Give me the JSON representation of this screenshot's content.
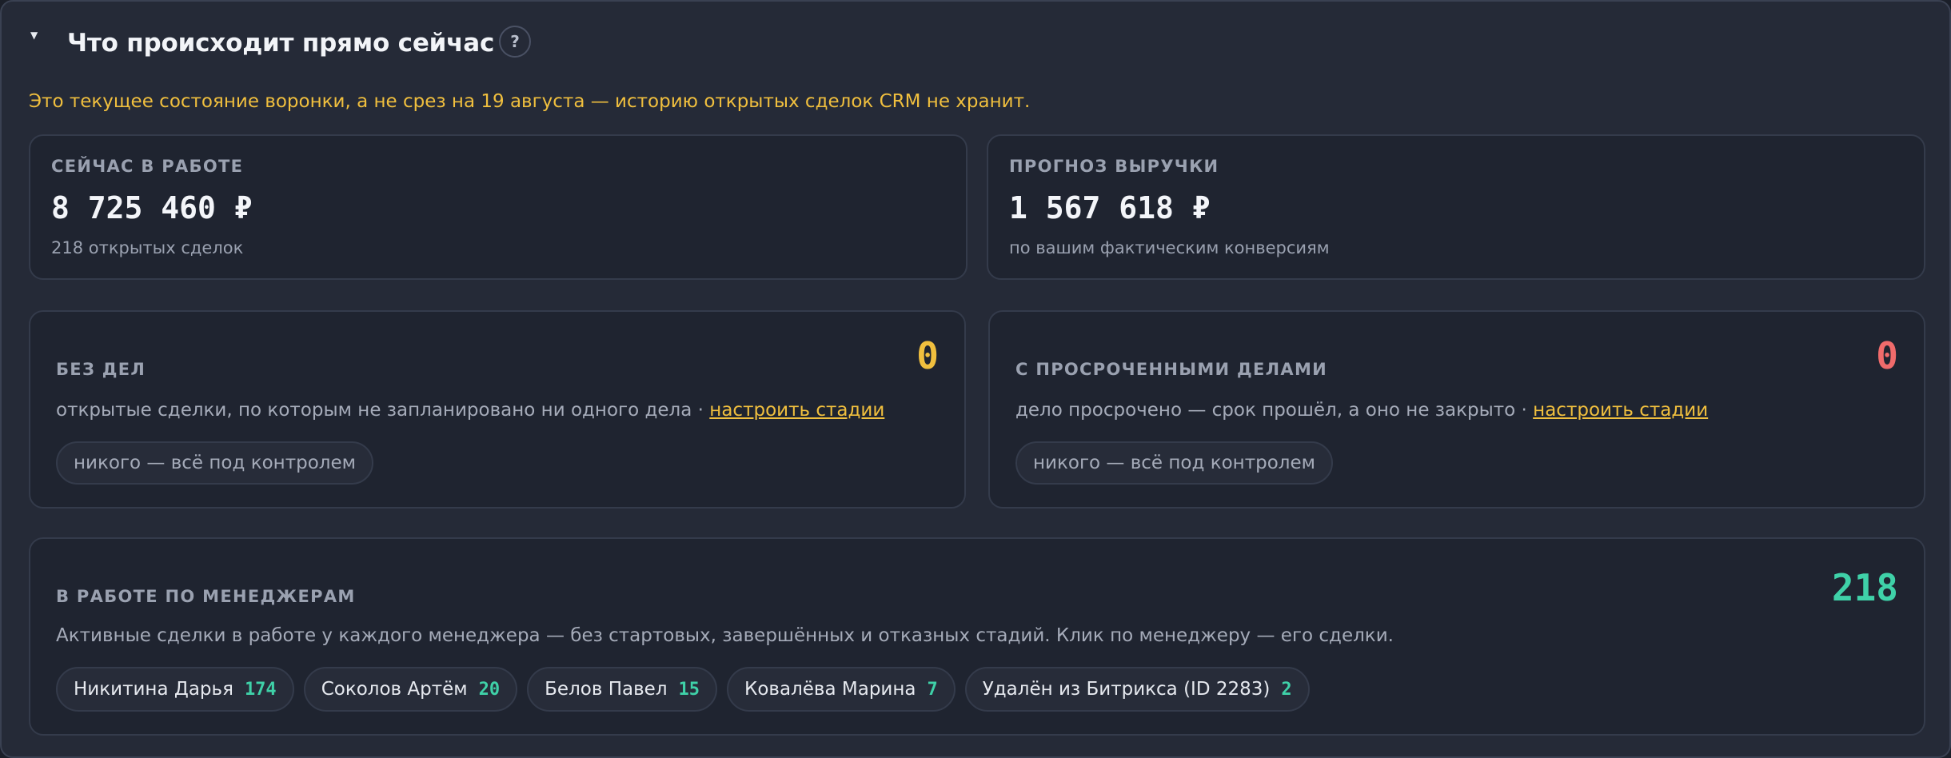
{
  "header": {
    "title": "Что происходит прямо сейчас",
    "help_label": "?"
  },
  "notice": "Это текущее состояние воронки, а не срез на 19 августа — историю открытых сделок CRM не хранит.",
  "in_work": {
    "label": "Сейчас в работе",
    "value": "8 725 460 ₽",
    "sub": "218 открытых сделок"
  },
  "forecast": {
    "label": "Прогноз выручки",
    "value": "1 567 618 ₽",
    "sub": "по вашим фактическим конверсиям"
  },
  "no_tasks": {
    "label": "Без дел",
    "count": "0",
    "count_color": "#f0bf3e",
    "desc": "открытые сделки, по которым не запланировано ни одного дела ·",
    "link": "настроить стадии",
    "status": "никого — всё под контролем"
  },
  "overdue": {
    "label": "С просроченными делами",
    "count": "0",
    "count_color": "#f06b6b",
    "desc": "дело просрочено — срок прошёл, а оно не закрыто ·",
    "link": "настроить стадии",
    "status": "никого — всё под контролем"
  },
  "managers": {
    "label": "В работе по менеджерам",
    "total": "218",
    "total_color": "#3fd1a8",
    "desc": "Активные сделки в работе у каждого менеджера — без стартовых, завершённых и отказных стадий. Клик по менеджеру — его сделки.",
    "items": [
      {
        "name": "Никитина Дарья",
        "count": "174"
      },
      {
        "name": "Соколов Артём",
        "count": "20"
      },
      {
        "name": "Белов Павел",
        "count": "15"
      },
      {
        "name": "Ковалёва Марина",
        "count": "7"
      },
      {
        "name": "Удалён из Битрикса (ID 2283)",
        "count": "2"
      }
    ]
  }
}
